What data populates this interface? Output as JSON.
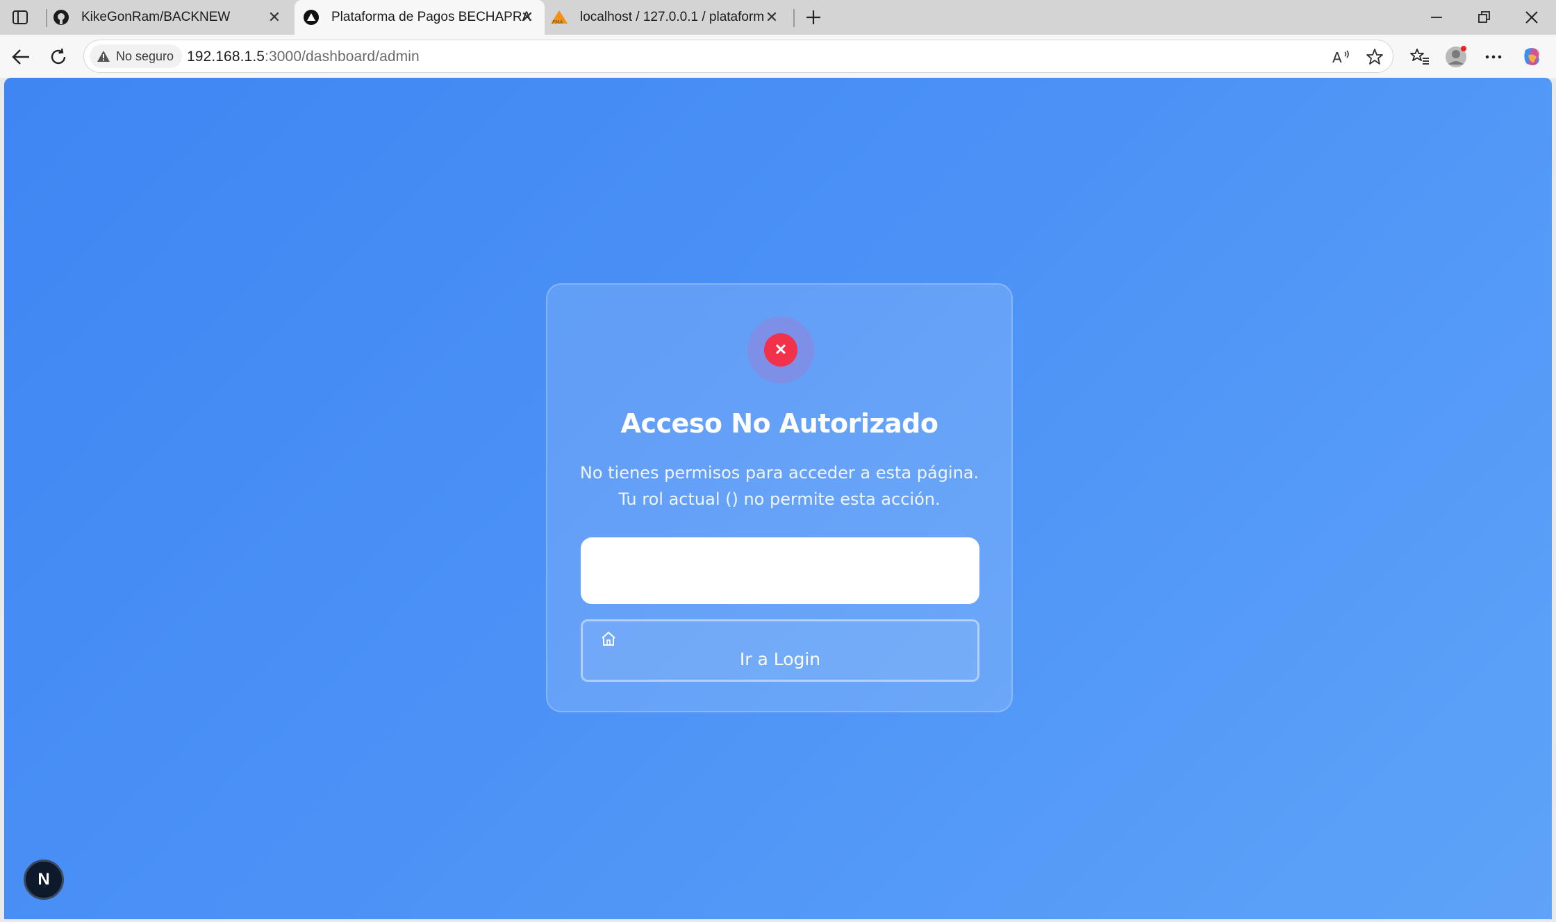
{
  "browser": {
    "tabs": [
      {
        "title": "KikeGonRam/BACKNEW",
        "favicon": "github-icon",
        "active": false
      },
      {
        "title": "Plataforma de Pagos BECHAPRA",
        "favicon": "vercel-triangle-icon",
        "active": true
      },
      {
        "title": "localhost / 127.0.0.1 / plataforma",
        "favicon": "phpmyadmin-icon",
        "active": false
      }
    ],
    "security_label": "No seguro",
    "url_host": "192.168.1.5",
    "url_path": ":3000/dashboard/admin"
  },
  "page": {
    "title": "Acceso No Autorizado",
    "message_line1": "No tienes permisos para acceder a esta página.",
    "message_line2": "Tu rol actual () no permite esta acción.",
    "primary_button_label": "",
    "login_button_label": "Ir a Login",
    "error_icon": "x-icon",
    "next_badge": "N"
  },
  "colors": {
    "background_start": "#3f86f3",
    "background_end": "#5ea3f8",
    "error_red": "#f2324a",
    "error_halo": "#7d8fe6"
  }
}
